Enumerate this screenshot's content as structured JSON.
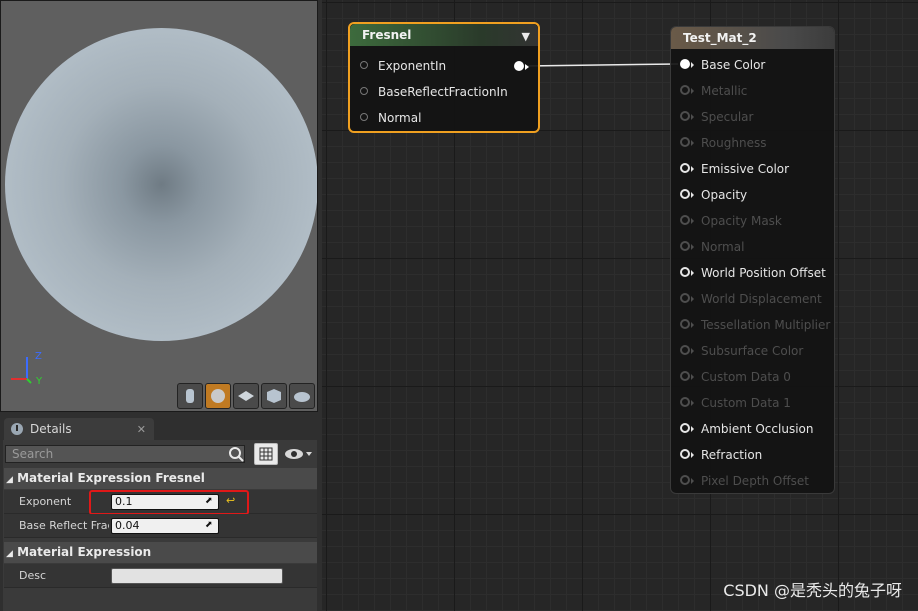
{
  "viewport": {
    "axis_z": "Z",
    "axis_y": "Y",
    "buttons": [
      "cylinder",
      "sphere",
      "plane",
      "cube",
      "custom-mesh"
    ],
    "active_button": "sphere"
  },
  "details": {
    "tab_label": "Details",
    "search_placeholder": "Search",
    "sections": [
      {
        "title": "Material Expression Fresnel",
        "rows": [
          {
            "label": "Exponent",
            "value": "0.1"
          },
          {
            "label": "Base Reflect Frac",
            "value": "0.04"
          }
        ]
      },
      {
        "title": "Material Expression",
        "rows": [
          {
            "label": "Desc",
            "value": ""
          }
        ]
      }
    ]
  },
  "fresnel_node": {
    "title": "Fresnel",
    "inputs": [
      "ExponentIn",
      "BaseReflectFractionIn",
      "Normal"
    ]
  },
  "material_node": {
    "title": "Test_Mat_2",
    "pins": [
      {
        "label": "Base Color",
        "enabled": true,
        "connected": true
      },
      {
        "label": "Metallic",
        "enabled": false
      },
      {
        "label": "Specular",
        "enabled": false
      },
      {
        "label": "Roughness",
        "enabled": false
      },
      {
        "label": "Emissive Color",
        "enabled": true
      },
      {
        "label": "Opacity",
        "enabled": true
      },
      {
        "label": "Opacity Mask",
        "enabled": false
      },
      {
        "label": "Normal",
        "enabled": false
      },
      {
        "label": "World Position Offset",
        "enabled": true
      },
      {
        "label": "World Displacement",
        "enabled": false
      },
      {
        "label": "Tessellation Multiplier",
        "enabled": false
      },
      {
        "label": "Subsurface Color",
        "enabled": false
      },
      {
        "label": "Custom Data 0",
        "enabled": false
      },
      {
        "label": "Custom Data 1",
        "enabled": false
      },
      {
        "label": "Ambient Occlusion",
        "enabled": true
      },
      {
        "label": "Refraction",
        "enabled": true
      },
      {
        "label": "Pixel Depth Offset",
        "enabled": false
      }
    ]
  },
  "watermark": "CSDN @是秃头的兔子呀",
  "colors": {
    "accent": "#f0a020",
    "highlight_box": "#e01818",
    "enabled_text": "#e6e6e6",
    "disabled_text": "#4e4e4e"
  }
}
